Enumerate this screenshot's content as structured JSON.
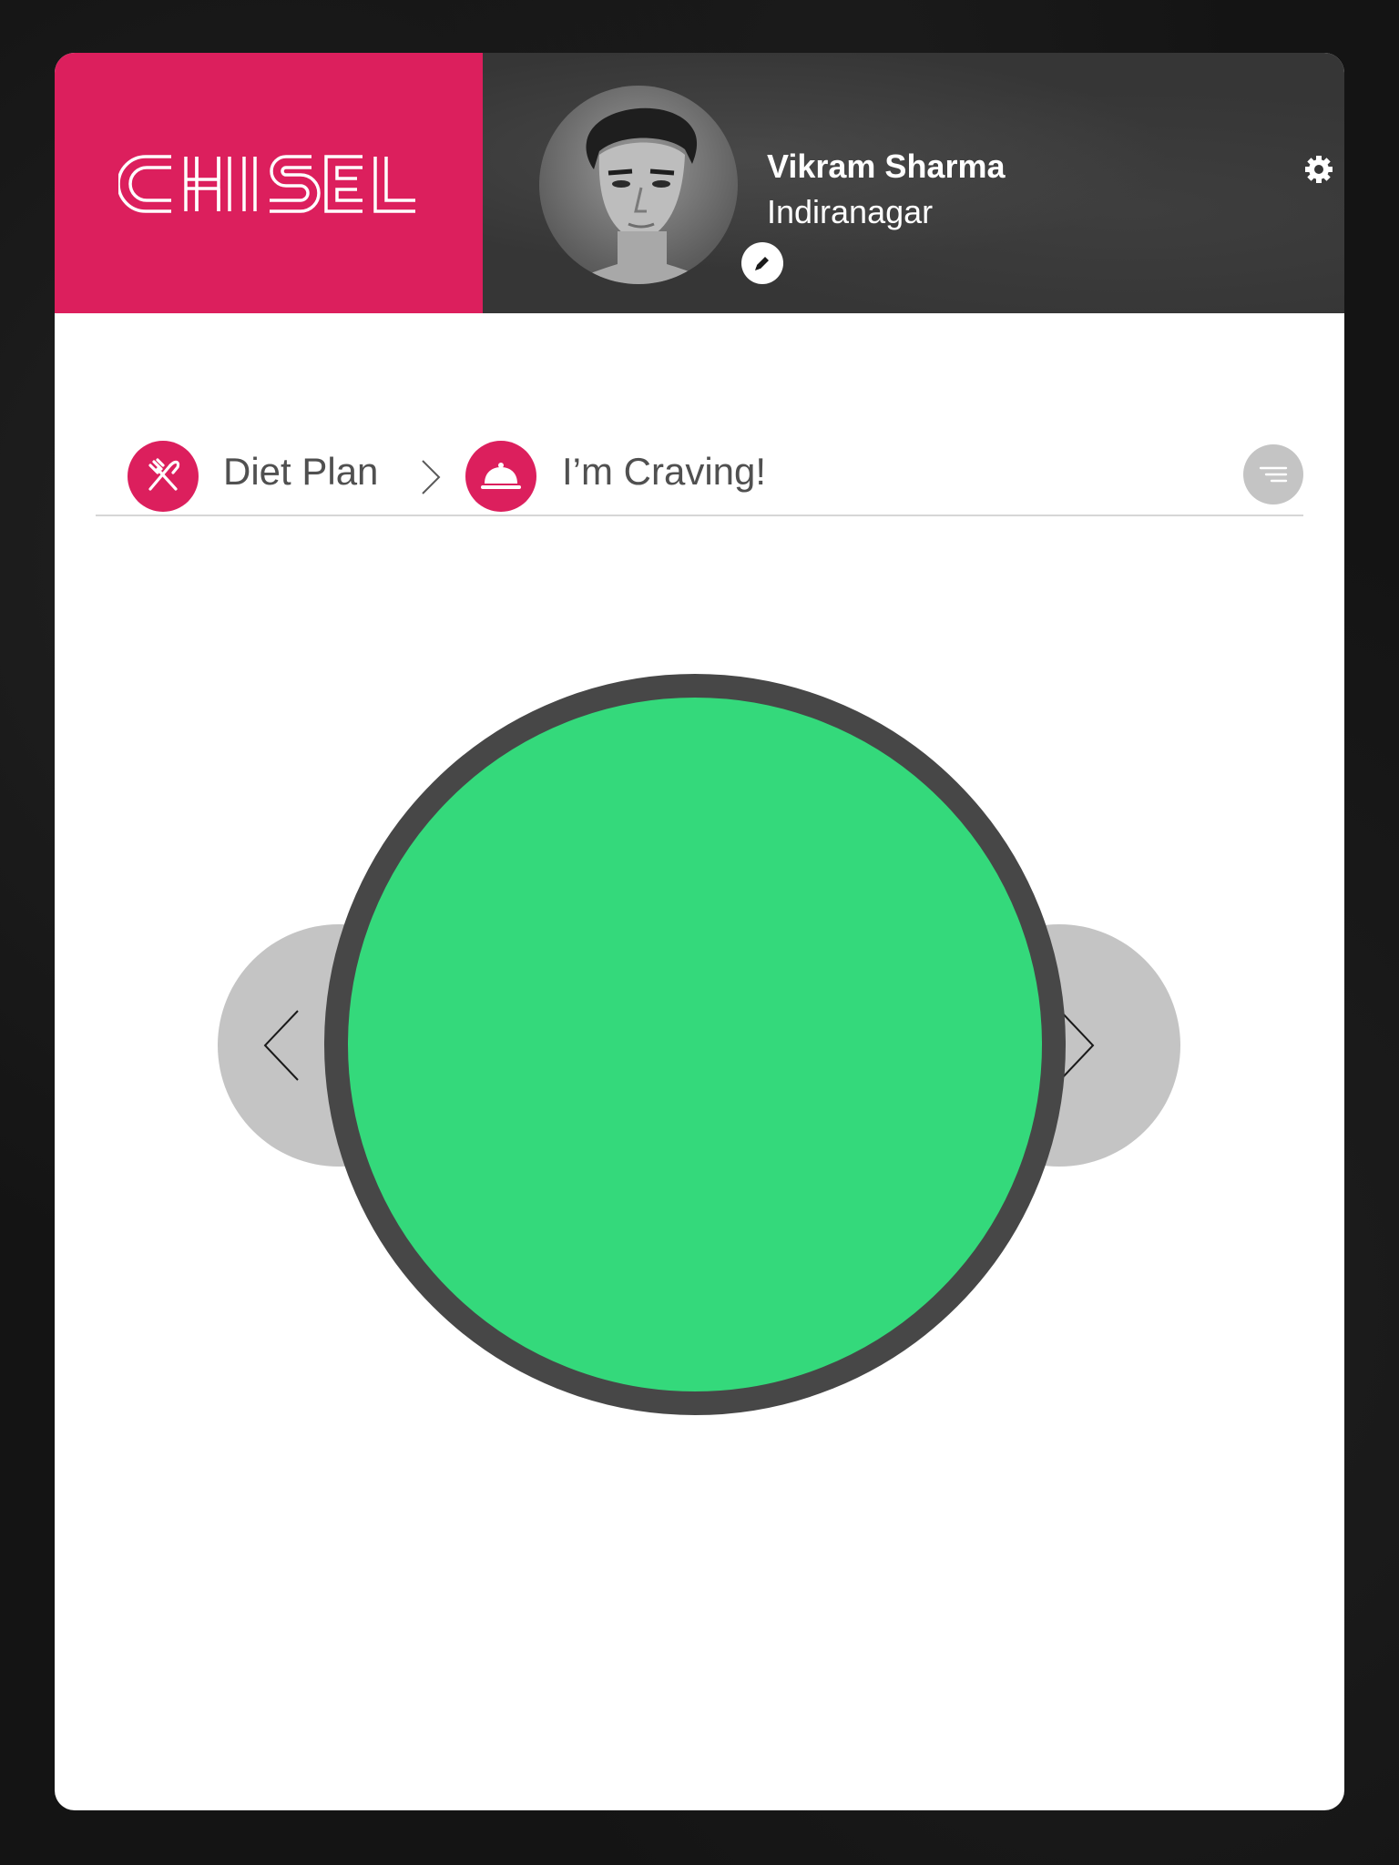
{
  "brand": {
    "logo_text": "CHISEL",
    "color": "#dc1f5d"
  },
  "user": {
    "name": "Vikram Sharma",
    "location": "Indiranagar",
    "avatar_icon": "profile-photo",
    "edit_icon": "pencil-icon"
  },
  "header": {
    "settings_icon": "gear-icon",
    "background_color": "#363636"
  },
  "breadcrumb": {
    "items": [
      {
        "label": "Diet Plan",
        "icon": "fork-knife-icon"
      },
      {
        "label": "I’m Craving!",
        "icon": "cloche-icon"
      }
    ],
    "separator_icon": "chevron-right-icon",
    "accent_color": "#dc1f5d"
  },
  "menu": {
    "icon": "sort-lines-icon"
  },
  "carousel": {
    "prev_icon": "chevron-left-icon",
    "next_icon": "chevron-right-icon",
    "selected_color": "#34d97b",
    "ring_color": "#474747"
  }
}
